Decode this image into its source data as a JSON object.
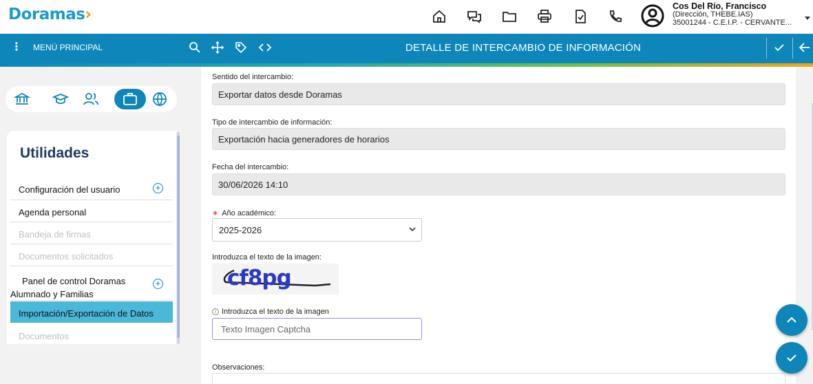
{
  "app": {
    "logo_main": "oramas",
    "logo_dot": "›",
    "logo_d": "D"
  },
  "user": {
    "name": "Cos Del Río, Francisco",
    "role": "(Dirección, THEBE.IAS)",
    "center": "35001244 - C.E.I.P. - CERVANTE..."
  },
  "header": {
    "menu_label": "MENÚ PRINCIPAL",
    "title": "DETALLE DE INTERCAMBIO DE INFORMACIÓN"
  },
  "sidebar": {
    "title": "Utilidades",
    "items": [
      {
        "label": "Configuración del usuario",
        "state": "normal"
      },
      {
        "label": "Agenda personal",
        "state": "normal"
      },
      {
        "label": "Bandeja de firmas",
        "state": "disabled"
      },
      {
        "label": "Documentos solicitados",
        "state": "disabled"
      },
      {
        "label": "Panel de control Doramas",
        "label2": "Alumnado y Familias",
        "state": "normal"
      },
      {
        "label": "Importación/Exportación de Datos",
        "state": "active"
      },
      {
        "label": "Documentos",
        "state": "disabled"
      }
    ]
  },
  "form": {
    "sentido_label": "Sentido del intercambio:",
    "sentido_value": "Exportar datos desde Doramas",
    "tipo_label": "Tipo de intercambio de información:",
    "tipo_value": "Exportación hacia generadores de horarios",
    "fecha_label": "Fecha del intercambio:",
    "fecha_value": "30/06/2026 14:10",
    "anio_required_mark": "∗",
    "anio_label": "Año académico:",
    "anio_value": "2025-2026",
    "captcha_image_label": "Introduzca el texto de la imagen:",
    "captcha_image_text": "cf8pg",
    "captcha_input_label": "Introduzca el texto de la imagen",
    "captcha_placeholder": "Texto Imagen Captcha",
    "observaciones_label": "Observaciones:"
  },
  "colors": {
    "brand_blue": "#0e86ba",
    "logo_blue": "#1b9bd1",
    "logo_orange": "#f39200",
    "active_item": "#4ab8d8"
  }
}
